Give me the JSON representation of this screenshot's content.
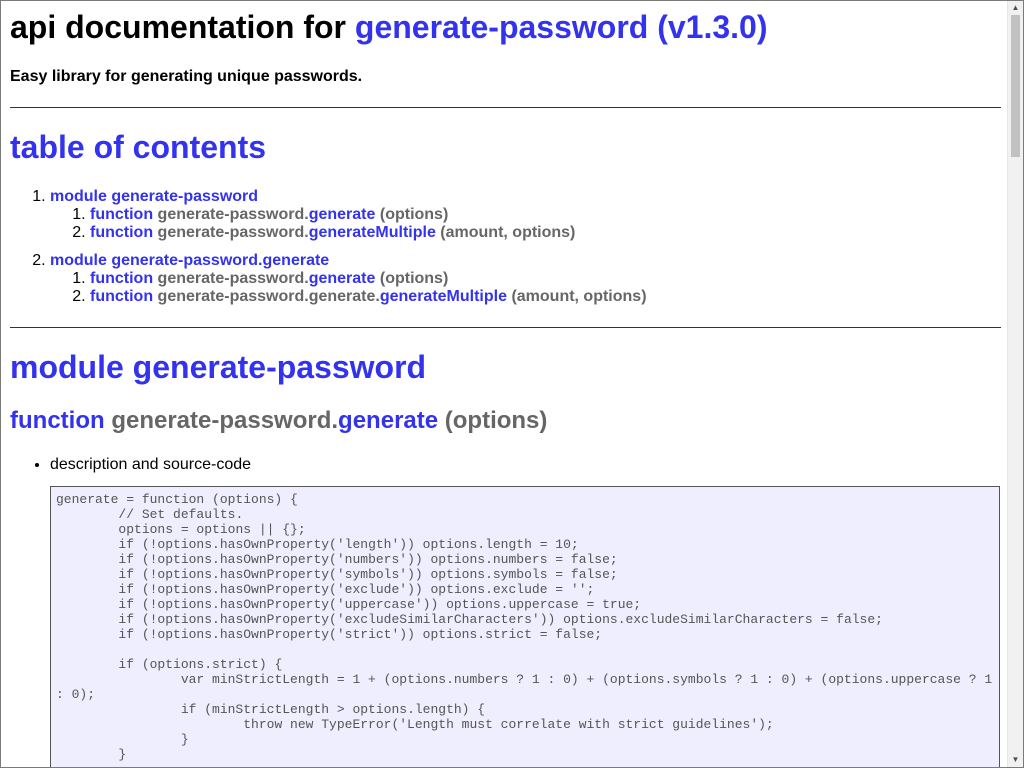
{
  "header": {
    "title_prefix": "api documentation for",
    "title_link": "generate-password (v1.3.0)",
    "subtitle": "Easy library for generating unique passwords."
  },
  "toc": {
    "heading": "table of contents",
    "modules": [
      {
        "label": "module generate-password",
        "functions": [
          {
            "keyword": "function",
            "path": "generate-password.",
            "name": "generate",
            "args": "(options)"
          },
          {
            "keyword": "function",
            "path": "generate-password.",
            "name": "generateMultiple",
            "args": "(amount, options)"
          }
        ]
      },
      {
        "label": "module generate-password.generate",
        "functions": [
          {
            "keyword": "function",
            "path": "generate-password.",
            "name": "generate",
            "args": "(options)"
          },
          {
            "keyword": "function",
            "path": "generate-password.generate.",
            "name": "generateMultiple",
            "args": "(amount, options)"
          }
        ]
      }
    ]
  },
  "module_section": {
    "heading": "module generate-password",
    "function": {
      "keyword": "function",
      "path": "generate-password.",
      "name": "generate",
      "args": "(options)"
    },
    "description_label": "description and source-code",
    "source_code": "generate = function (options) {\n\t// Set defaults.\n\toptions = options || {};\n\tif (!options.hasOwnProperty('length')) options.length = 10;\n\tif (!options.hasOwnProperty('numbers')) options.numbers = false;\n\tif (!options.hasOwnProperty('symbols')) options.symbols = false;\n\tif (!options.hasOwnProperty('exclude')) options.exclude = '';\n\tif (!options.hasOwnProperty('uppercase')) options.uppercase = true;\n\tif (!options.hasOwnProperty('excludeSimilarCharacters')) options.excludeSimilarCharacters = false;\n\tif (!options.hasOwnProperty('strict')) options.strict = false;\n\n\tif (options.strict) {\n\t\tvar minStrictLength = 1 + (options.numbers ? 1 : 0) + (options.symbols ? 1 : 0) + (options.uppercase ? 1 : 0);\n\t\tif (minStrictLength > options.length) {\n\t\t\tthrow new TypeError('Length must correlate with strict guidelines');\n\t\t}\n\t}"
  },
  "colors": {
    "link": "#3333ee",
    "muted": "#666666",
    "code_background": "#eeeeff"
  }
}
